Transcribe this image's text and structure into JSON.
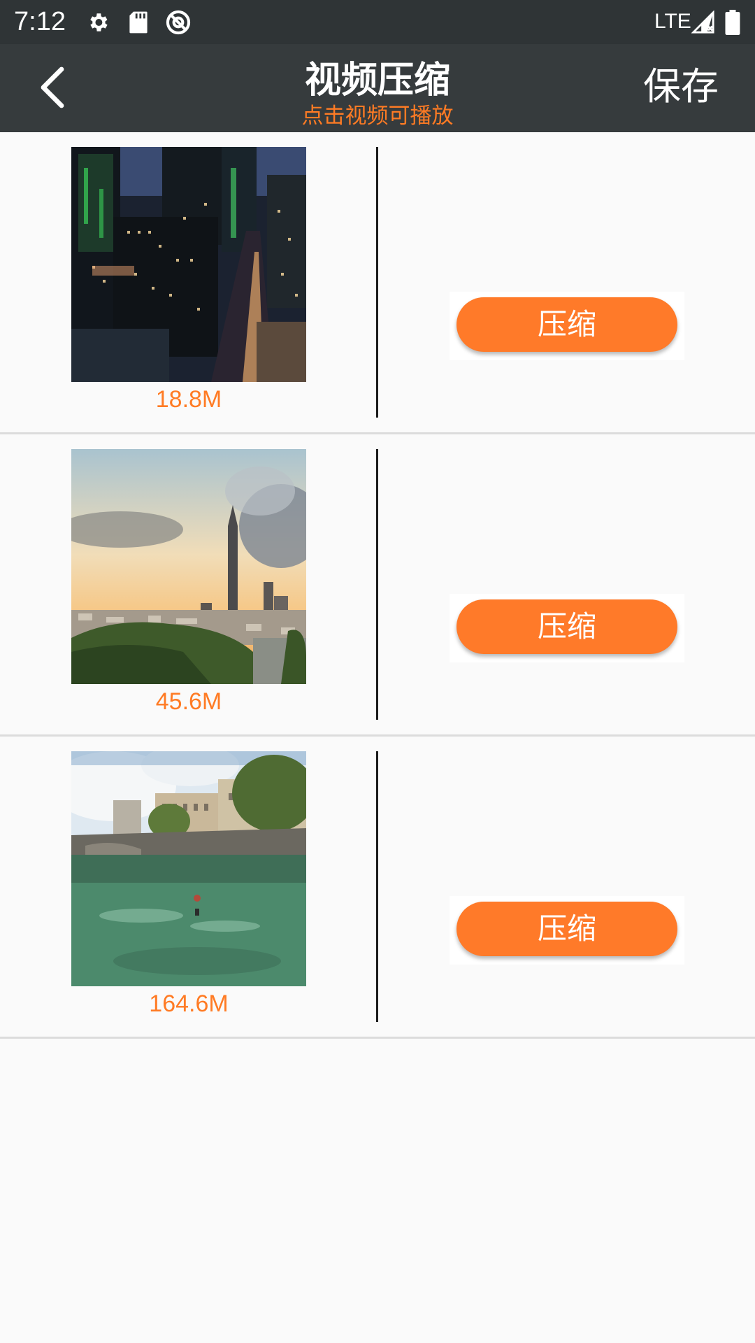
{
  "status_bar": {
    "time": "7:12",
    "network": "LTE",
    "icons": [
      "settings-icon",
      "sd-card-icon",
      "at-sign-icon",
      "signal-icon",
      "battery-icon"
    ]
  },
  "app_bar": {
    "title": "视频压缩",
    "subtitle": "点击视频可播放",
    "save_label": "保存",
    "accent_color": "#ff7b24",
    "background_color": "#363b3d"
  },
  "videos": [
    {
      "size": "18.8M",
      "button_label": "压缩",
      "thumbnail": "night-city"
    },
    {
      "size": "45.6M",
      "button_label": "压缩",
      "thumbnail": "sunset-skyline"
    },
    {
      "size": "164.6M",
      "button_label": "压缩",
      "thumbnail": "river-town"
    }
  ]
}
